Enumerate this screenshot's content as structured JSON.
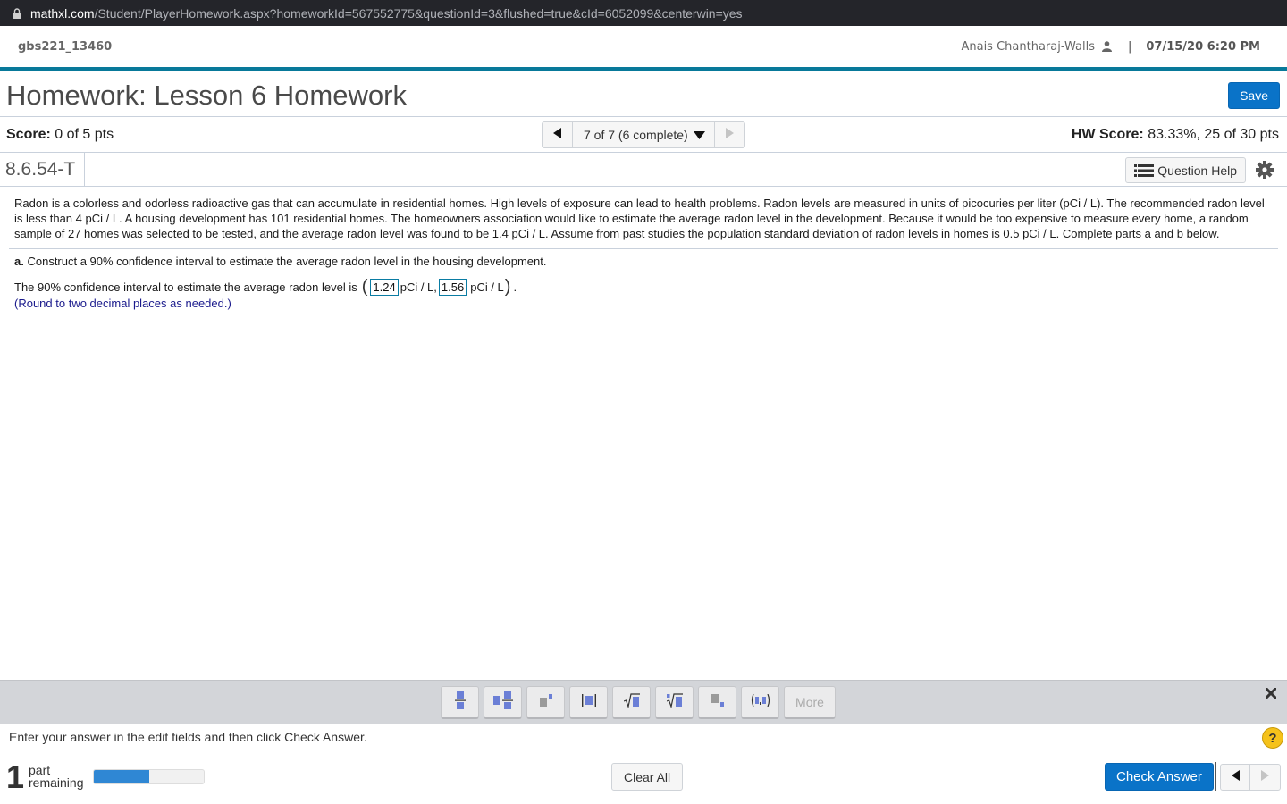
{
  "browser": {
    "url_domain": "mathxl.com",
    "url_path": "/Student/PlayerHomework.aspx?homeworkId=567552775&questionId=3&flushed=true&cId=6052099&centerwin=yes"
  },
  "header": {
    "course_id": "gbs221_13460",
    "user_name": "Anais Chantharaj-Walls",
    "separator": "|",
    "datetime": "07/15/20 6:20 PM"
  },
  "title_bar": {
    "title": "Homework: Lesson 6 Homework",
    "save_label": "Save"
  },
  "score_bar": {
    "score_label": "Score:",
    "score_value": "0 of 5 pts",
    "question_selector": "7 of 7 (6 complete)",
    "hw_score_label": "HW Score:",
    "hw_score_value": "83.33%, 25 of 30 pts"
  },
  "question": {
    "id": "8.6.54-T",
    "help_label": "Question Help",
    "problem_text": "Radon is a colorless and odorless radioactive gas that can accumulate in residential homes. High levels of exposure can lead to health problems. Radon levels are measured in units of picocuries per liter (pCi / L). The recommended radon level is less than 4 pCi / L. A housing development has 101 residential homes. The homeowners association would like to estimate the average radon level in the development. Because it would be too expensive to measure every home, a random sample of 27 homes was selected to be tested, and the average radon level was found to be 1.4 pCi / L. Assume from past studies the population standard deviation of radon levels in homes is 0.5 pCi / L. Complete parts a and b below.",
    "part_a_label": "a.",
    "part_a_text": "Construct a 90% confidence interval to estimate the average radon level in the housing development.",
    "answer_prefix": "The 90% confidence interval to estimate the average radon level is",
    "open_paren": "(",
    "lower_value": "1.24",
    "unit_1": "pCi / L,",
    "upper_value": "1.56",
    "unit_2": "pCi / L",
    "close_paren": ")",
    "period": ".",
    "round_note": "(Round to two decimal places as needed.)"
  },
  "palette": {
    "tools": [
      "fraction",
      "mixed-number",
      "exponent",
      "absolute-value",
      "square-root",
      "nth-root",
      "subscript",
      "ordered-pair"
    ],
    "more_label": "More"
  },
  "instructions": {
    "text": "Enter your answer in the edit fields and then click Check Answer.",
    "help_symbol": "?"
  },
  "bottom": {
    "parts_remaining_count": "1",
    "parts_label_line1": "part",
    "parts_label_line2": "remaining",
    "progress_fraction": 0.5,
    "clear_all_label": "Clear All",
    "check_answer_label": "Check Answer"
  },
  "colors": {
    "accent_blue": "#0a73c8",
    "header_rule": "#08799a",
    "progress_fill": "#2f87d4",
    "help_yellow": "#f5c21b",
    "round_note": "#1a1a8c"
  }
}
